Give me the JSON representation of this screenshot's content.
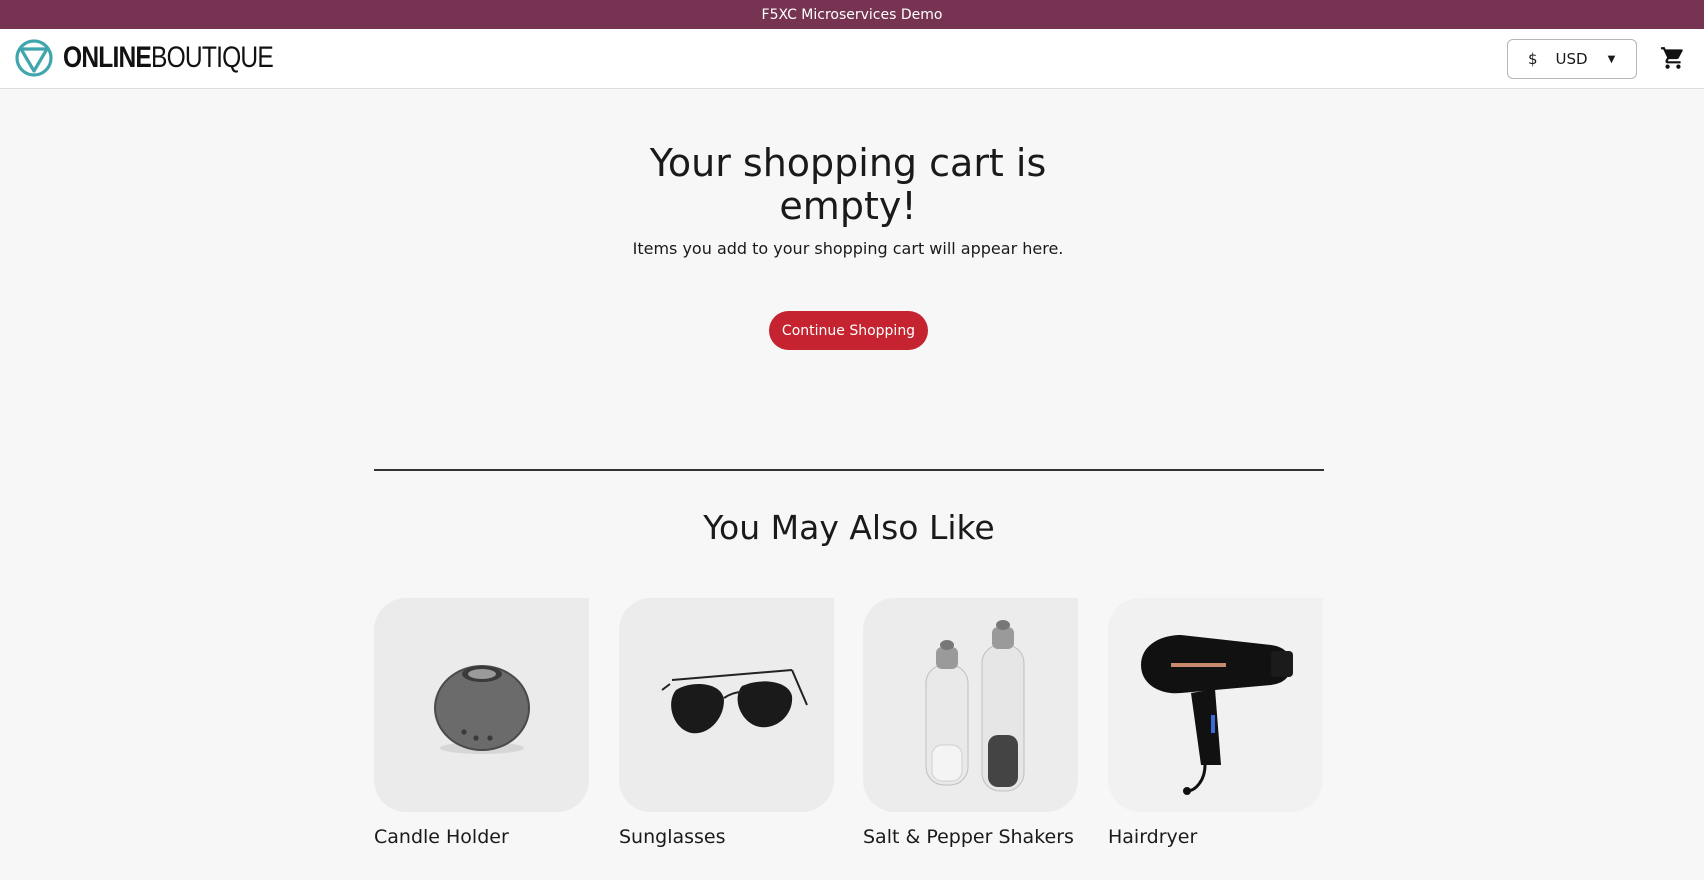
{
  "banner": {
    "text": "F5XC Microservices Demo"
  },
  "header": {
    "logo": {
      "bold": "ONLINE",
      "thin": "BOUTIQUE"
    },
    "currency": {
      "symbol": "$",
      "code": "USD"
    },
    "cart_icon": "cart-icon"
  },
  "main": {
    "title": "Your shopping cart is empty!",
    "subtitle": "Items you add to your shopping cart will appear here.",
    "continue_label": "Continue Shopping"
  },
  "recommendations": {
    "title": "You May Also Like",
    "items": [
      {
        "name": "Candle Holder"
      },
      {
        "name": "Sunglasses"
      },
      {
        "name": "Salt & Pepper Shakers"
      },
      {
        "name": "Hairdryer"
      }
    ]
  },
  "colors": {
    "banner": "#763452",
    "button": "#c4232f",
    "logo_teal": "#41a5ad"
  }
}
